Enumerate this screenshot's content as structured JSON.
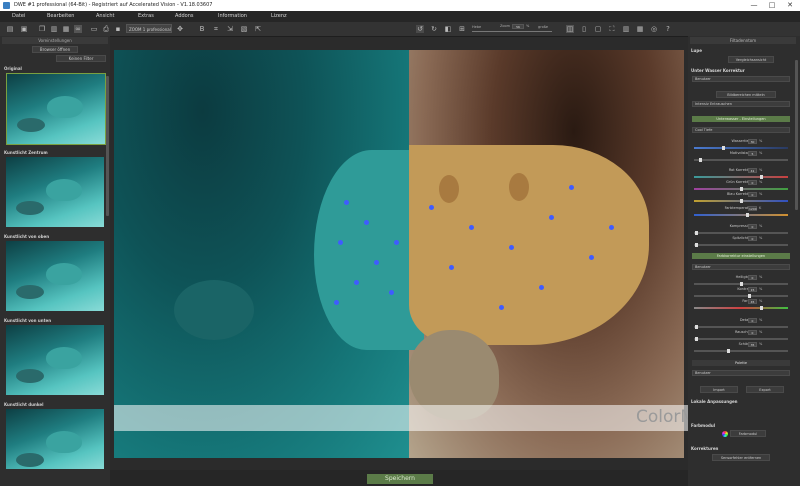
{
  "window": {
    "title": "DWE #1 professional (64-Bit) - Registriert auf Accelerated Vision - V1.18.03607",
    "minimize": "—",
    "maximize": "□",
    "close": "✕"
  },
  "menu": [
    "Datei",
    "Bearbeiten",
    "Ansicht",
    "Extras",
    "Addons",
    "Information",
    "Lizenz"
  ],
  "toolbar": {
    "zoom_select": "ZOOM 1 professional",
    "view_slider_left": "Hebe",
    "view_slider_label": "Zoom",
    "view_value": "56",
    "view_unit": "%",
    "view_slider_right": "große"
  },
  "left_panel": {
    "header": "Voreinstellungen",
    "browse_button": "Browser öffnen",
    "filter_button": "Keinen Filter",
    "thumbnails": [
      {
        "label": "Original"
      },
      {
        "label": "Kunstlicht Zentrum"
      },
      {
        "label": "Kunstlicht von oben"
      },
      {
        "label": "Kunstlicht von unten"
      },
      {
        "label": "Kunstlicht dunkel"
      }
    ]
  },
  "bottom": {
    "save_button": "Speichern"
  },
  "watermark": "ColorMango.com",
  "right_panel": {
    "header": "Filtadenntom",
    "lupe_section": "Lupe",
    "lupe_button": "Vergleichsansicht",
    "korrektur_section": "Unter Wasser Korrektur",
    "preset_dropdown": "Benutzer",
    "btn_auto": "Bildbereichen mitteln",
    "dropdown_2": "Intensiv Entrauschen",
    "green_bar_1": "Unterwasser - Einstellungen",
    "dropdown_3": "Cool Tiefe",
    "sliders_a": [
      {
        "label": "Wassertiefe",
        "value": "30",
        "unit": "%"
      },
      {
        "label": "Motivdistanz",
        "value": "5",
        "unit": "%"
      }
    ],
    "sliders_b": [
      {
        "label": "Rot Korrektur",
        "value": "41",
        "unit": "%"
      },
      {
        "label": "Grün Korrektur",
        "value": "0",
        "unit": "%"
      },
      {
        "label": "Blau Korrektur",
        "value": "0",
        "unit": "%"
      },
      {
        "label": "Farbtemperatur",
        "value": "1200",
        "unit": "K"
      }
    ],
    "sliders_c": [
      {
        "label": "Kompression",
        "value": "0",
        "unit": "%"
      },
      {
        "label": "Spitzlichter",
        "value": "0",
        "unit": "%"
      }
    ],
    "green_bar_2": "Farbkorrektur einstellungen",
    "dropdown_4": "Benutzer",
    "sliders_d": [
      {
        "label": "Helligkeit",
        "value": "0",
        "unit": "%"
      },
      {
        "label": "Kontrast",
        "value": "15",
        "unit": "%"
      },
      {
        "label": "Farbe",
        "value": "45",
        "unit": "%"
      }
    ],
    "sliders_e": [
      {
        "label": "Details",
        "value": "0",
        "unit": "%"
      },
      {
        "label": "Rauschen",
        "value": "0",
        "unit": "%"
      },
      {
        "label": "Schärfe",
        "value": "35",
        "unit": "%"
      }
    ],
    "palette_section": "Palette",
    "palette_dropdown": "Benutzer",
    "import_button": "Import",
    "export_button": "Export",
    "local_section": "Lokale Anpassungen",
    "farbmodul_section": "Farbmodul",
    "farbmodul_button": "Farbmodul",
    "korrekturen_section": "Korrekturen",
    "sensor_button": "Sensorfehler entfernen"
  }
}
